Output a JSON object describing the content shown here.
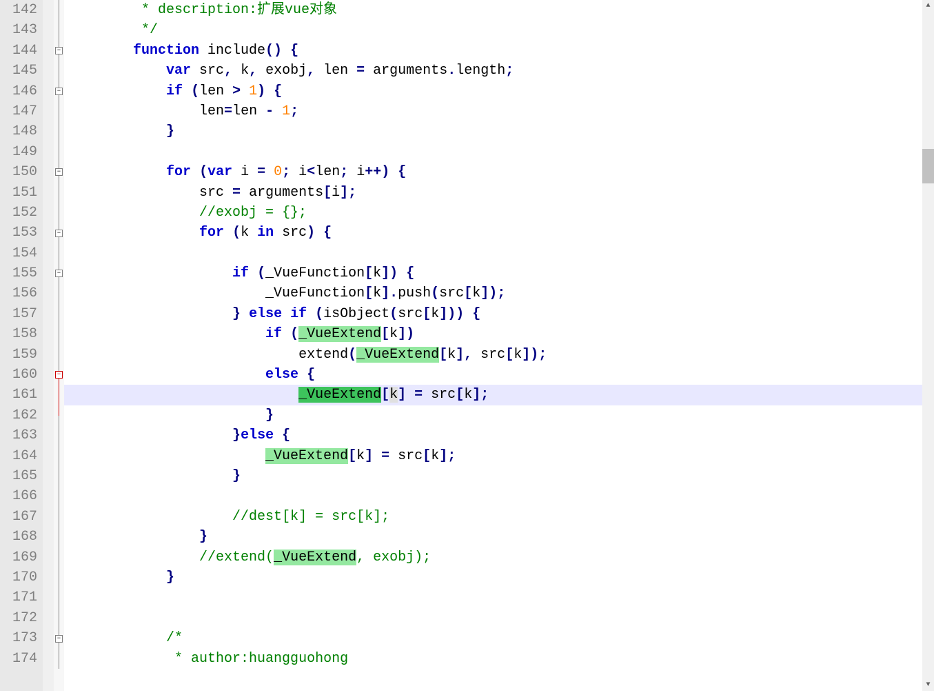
{
  "editor": {
    "startLine": 142,
    "currentLine": 161,
    "foldGutter": {
      "boxes": [
        {
          "line": 144,
          "type": "minus"
        },
        {
          "line": 146,
          "type": "minus"
        },
        {
          "line": 150,
          "type": "minus"
        },
        {
          "line": 153,
          "type": "minus"
        },
        {
          "line": 155,
          "type": "minus"
        },
        {
          "line": 160,
          "type": "minus",
          "red": true
        },
        {
          "line": 173,
          "type": "minus"
        }
      ]
    },
    "lines": [
      {
        "n": 142,
        "indent": 8,
        "tokens": [
          {
            "t": " * description:扩展vue对象",
            "c": "cmt"
          }
        ]
      },
      {
        "n": 143,
        "indent": 8,
        "tokens": [
          {
            "t": " */",
            "c": "cmt"
          }
        ]
      },
      {
        "n": 144,
        "indent": 8,
        "tokens": [
          {
            "t": "function",
            "c": "kw"
          },
          {
            "t": " include"
          },
          {
            "t": "()",
            "c": "op"
          },
          {
            "t": " "
          },
          {
            "t": "{",
            "c": "op"
          }
        ]
      },
      {
        "n": 145,
        "indent": 12,
        "tokens": [
          {
            "t": "var",
            "c": "kw"
          },
          {
            "t": " src"
          },
          {
            "t": ",",
            "c": "op"
          },
          {
            "t": " k"
          },
          {
            "t": ",",
            "c": "op"
          },
          {
            "t": " exobj"
          },
          {
            "t": ",",
            "c": "op"
          },
          {
            "t": " len "
          },
          {
            "t": "=",
            "c": "op"
          },
          {
            "t": " arguments"
          },
          {
            "t": ".",
            "c": "op"
          },
          {
            "t": "length"
          },
          {
            "t": ";",
            "c": "op"
          }
        ]
      },
      {
        "n": 146,
        "indent": 12,
        "tokens": [
          {
            "t": "if",
            "c": "kw"
          },
          {
            "t": " "
          },
          {
            "t": "(",
            "c": "op"
          },
          {
            "t": "len "
          },
          {
            "t": ">",
            "c": "op"
          },
          {
            "t": " "
          },
          {
            "t": "1",
            "c": "num"
          },
          {
            "t": ")",
            "c": "op"
          },
          {
            "t": " "
          },
          {
            "t": "{",
            "c": "op"
          }
        ]
      },
      {
        "n": 147,
        "indent": 16,
        "tokens": [
          {
            "t": "len"
          },
          {
            "t": "=",
            "c": "op"
          },
          {
            "t": "len "
          },
          {
            "t": "-",
            "c": "op"
          },
          {
            "t": " "
          },
          {
            "t": "1",
            "c": "num"
          },
          {
            "t": ";",
            "c": "op"
          }
        ]
      },
      {
        "n": 148,
        "indent": 12,
        "tokens": [
          {
            "t": "}",
            "c": "op"
          }
        ]
      },
      {
        "n": 149,
        "indent": 0,
        "tokens": []
      },
      {
        "n": 150,
        "indent": 12,
        "tokens": [
          {
            "t": "for",
            "c": "kw"
          },
          {
            "t": " "
          },
          {
            "t": "(",
            "c": "op"
          },
          {
            "t": "var",
            "c": "kw"
          },
          {
            "t": " i "
          },
          {
            "t": "=",
            "c": "op"
          },
          {
            "t": " "
          },
          {
            "t": "0",
            "c": "num"
          },
          {
            "t": ";",
            "c": "op"
          },
          {
            "t": " i"
          },
          {
            "t": "<",
            "c": "op"
          },
          {
            "t": "len"
          },
          {
            "t": ";",
            "c": "op"
          },
          {
            "t": " i"
          },
          {
            "t": "++)",
            "c": "op"
          },
          {
            "t": " "
          },
          {
            "t": "{",
            "c": "op"
          }
        ]
      },
      {
        "n": 151,
        "indent": 16,
        "tokens": [
          {
            "t": "src "
          },
          {
            "t": "=",
            "c": "op"
          },
          {
            "t": " arguments"
          },
          {
            "t": "[",
            "c": "op"
          },
          {
            "t": "i"
          },
          {
            "t": "];",
            "c": "op"
          }
        ]
      },
      {
        "n": 152,
        "indent": 16,
        "tokens": [
          {
            "t": "//exobj = {};",
            "c": "cmt"
          }
        ]
      },
      {
        "n": 153,
        "indent": 16,
        "tokens": [
          {
            "t": "for",
            "c": "kw"
          },
          {
            "t": " "
          },
          {
            "t": "(",
            "c": "op"
          },
          {
            "t": "k "
          },
          {
            "t": "in",
            "c": "kw"
          },
          {
            "t": " src"
          },
          {
            "t": ")",
            "c": "op"
          },
          {
            "t": " "
          },
          {
            "t": "{",
            "c": "op"
          }
        ]
      },
      {
        "n": 154,
        "indent": 0,
        "tokens": []
      },
      {
        "n": 155,
        "indent": 20,
        "tokens": [
          {
            "t": "if",
            "c": "kw"
          },
          {
            "t": " "
          },
          {
            "t": "(",
            "c": "op"
          },
          {
            "t": "_VueFunction"
          },
          {
            "t": "[",
            "c": "op"
          },
          {
            "t": "k"
          },
          {
            "t": "])",
            "c": "op"
          },
          {
            "t": " "
          },
          {
            "t": "{",
            "c": "op"
          }
        ]
      },
      {
        "n": 156,
        "indent": 24,
        "tokens": [
          {
            "t": "_VueFunction"
          },
          {
            "t": "[",
            "c": "op"
          },
          {
            "t": "k"
          },
          {
            "t": "].",
            "c": "op"
          },
          {
            "t": "push"
          },
          {
            "t": "(",
            "c": "op"
          },
          {
            "t": "src"
          },
          {
            "t": "[",
            "c": "op"
          },
          {
            "t": "k"
          },
          {
            "t": "]);",
            "c": "op"
          }
        ]
      },
      {
        "n": 157,
        "indent": 20,
        "tokens": [
          {
            "t": "}",
            "c": "op"
          },
          {
            "t": " "
          },
          {
            "t": "else",
            "c": "kw"
          },
          {
            "t": " "
          },
          {
            "t": "if",
            "c": "kw"
          },
          {
            "t": " "
          },
          {
            "t": "(",
            "c": "op"
          },
          {
            "t": "isObject"
          },
          {
            "t": "(",
            "c": "op"
          },
          {
            "t": "src"
          },
          {
            "t": "[",
            "c": "op"
          },
          {
            "t": "k"
          },
          {
            "t": "]))",
            "c": "op"
          },
          {
            "t": " "
          },
          {
            "t": "{",
            "c": "op"
          }
        ]
      },
      {
        "n": 158,
        "indent": 24,
        "tokens": [
          {
            "t": "if",
            "c": "kw"
          },
          {
            "t": " "
          },
          {
            "t": "(",
            "c": "op"
          },
          {
            "t": "_VueExtend",
            "c": "hl"
          },
          {
            "t": "[",
            "c": "op"
          },
          {
            "t": "k"
          },
          {
            "t": "])",
            "c": "op"
          }
        ]
      },
      {
        "n": 159,
        "indent": 28,
        "tokens": [
          {
            "t": "extend"
          },
          {
            "t": "(",
            "c": "op"
          },
          {
            "t": "_VueExtend",
            "c": "hl"
          },
          {
            "t": "[",
            "c": "op"
          },
          {
            "t": "k"
          },
          {
            "t": "],",
            "c": "op"
          },
          {
            "t": " src"
          },
          {
            "t": "[",
            "c": "op"
          },
          {
            "t": "k"
          },
          {
            "t": "]);",
            "c": "op"
          }
        ]
      },
      {
        "n": 160,
        "indent": 24,
        "tokens": [
          {
            "t": "else",
            "c": "kw"
          },
          {
            "t": " "
          },
          {
            "t": "{",
            "c": "op"
          }
        ]
      },
      {
        "n": 161,
        "indent": 28,
        "current": true,
        "tokens": [
          {
            "t": "_VueExtend",
            "c": "hl-cur"
          },
          {
            "t": "[",
            "c": "op"
          },
          {
            "t": "k",
            "c": "find"
          },
          {
            "t": "]",
            "c": "op"
          },
          {
            "t": " "
          },
          {
            "t": "=",
            "c": "op"
          },
          {
            "t": " src"
          },
          {
            "t": "[",
            "c": "op"
          },
          {
            "t": "k"
          },
          {
            "t": "];",
            "c": "op"
          }
        ]
      },
      {
        "n": 162,
        "indent": 24,
        "tokens": [
          {
            "t": "}",
            "c": "op"
          }
        ]
      },
      {
        "n": 163,
        "indent": 20,
        "tokens": [
          {
            "t": "}",
            "c": "op"
          },
          {
            "t": "else",
            "c": "kw"
          },
          {
            "t": " "
          },
          {
            "t": "{",
            "c": "op"
          }
        ]
      },
      {
        "n": 164,
        "indent": 24,
        "tokens": [
          {
            "t": "_VueExtend",
            "c": "hl"
          },
          {
            "t": "[",
            "c": "op"
          },
          {
            "t": "k"
          },
          {
            "t": "]",
            "c": "op"
          },
          {
            "t": " "
          },
          {
            "t": "=",
            "c": "op"
          },
          {
            "t": " src"
          },
          {
            "t": "[",
            "c": "op"
          },
          {
            "t": "k"
          },
          {
            "t": "];",
            "c": "op"
          }
        ]
      },
      {
        "n": 165,
        "indent": 20,
        "tokens": [
          {
            "t": "}",
            "c": "op"
          }
        ]
      },
      {
        "n": 166,
        "indent": 0,
        "tokens": []
      },
      {
        "n": 167,
        "indent": 20,
        "tokens": [
          {
            "t": "//dest[k] = src[k];",
            "c": "cmt"
          }
        ]
      },
      {
        "n": 168,
        "indent": 16,
        "tokens": [
          {
            "t": "}",
            "c": "op"
          }
        ]
      },
      {
        "n": 169,
        "indent": 16,
        "tokens": [
          {
            "t": "//extend(",
            "c": "cmt"
          },
          {
            "t": "_VueExtend",
            "c": "hl"
          },
          {
            "t": ", exobj);",
            "c": "cmt"
          }
        ]
      },
      {
        "n": 170,
        "indent": 12,
        "tokens": [
          {
            "t": "}",
            "c": "op"
          }
        ]
      },
      {
        "n": 171,
        "indent": 0,
        "tokens": []
      },
      {
        "n": 172,
        "indent": 0,
        "tokens": []
      },
      {
        "n": 173,
        "indent": 12,
        "tokens": [
          {
            "t": "/*",
            "c": "cmt"
          }
        ]
      },
      {
        "n": 174,
        "indent": 12,
        "tokens": [
          {
            "t": " * author:huangguohong",
            "c": "cmt"
          }
        ]
      }
    ],
    "scrollbar": {
      "thumbTop": 216,
      "thumbHeight": 50
    }
  }
}
